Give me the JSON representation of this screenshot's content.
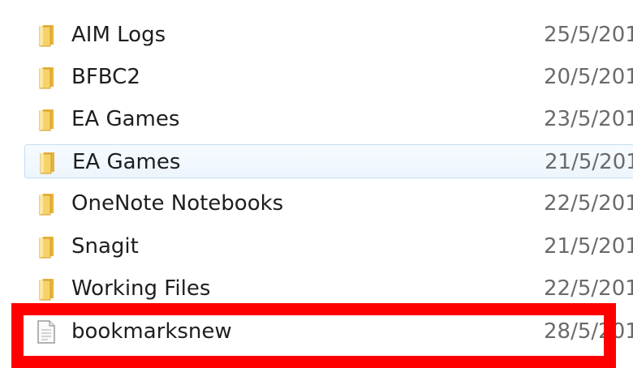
{
  "files": [
    {
      "name": "AIM Logs",
      "date": "25/5/201",
      "icon": "folder-icon"
    },
    {
      "name": "BFBC2",
      "date": "20/5/201",
      "icon": "folder-icon"
    },
    {
      "name": "EA Games",
      "date": "23/5/201",
      "icon": "folder-icon"
    },
    {
      "name": "EA Games",
      "date": "21/5/201",
      "icon": "folder-icon",
      "selected": true
    },
    {
      "name": "OneNote Notebooks",
      "date": "22/5/201",
      "icon": "folder-icon"
    },
    {
      "name": "Snagit",
      "date": "21/5/201",
      "icon": "folder-icon"
    },
    {
      "name": "Working Files",
      "date": "22/5/201",
      "icon": "folder-icon"
    },
    {
      "name": "bookmarksnew",
      "date": "28/5/201",
      "icon": "document-icon"
    }
  ],
  "colors": {
    "highlight": "#ff0000",
    "selection_border": "#c6dcf3",
    "folder": "#f2c94c"
  }
}
